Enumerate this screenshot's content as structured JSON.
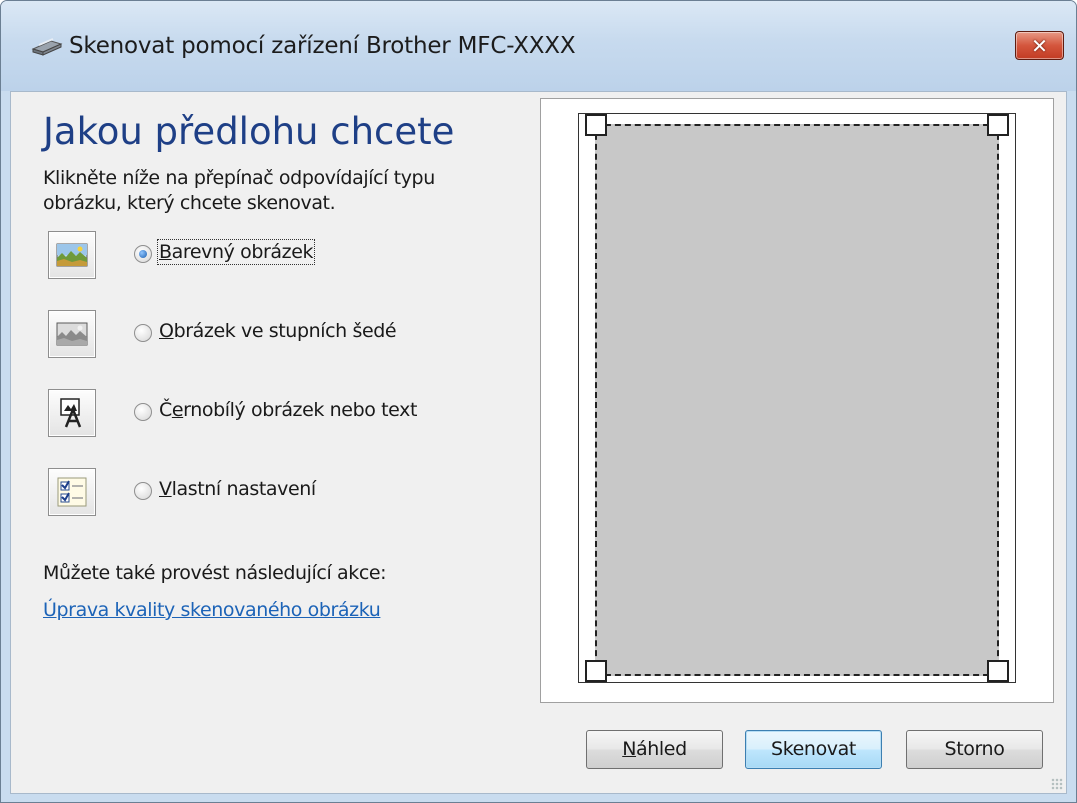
{
  "window": {
    "title": "Skenovat pomocí zařízení  Brother MFC-XXXX",
    "close_label": "✕"
  },
  "main": {
    "heading": "Jakou předlohu chcete",
    "instructions": "Klikněte níže na přepínač odpovídající typu obrázku, který chcete skenovat.",
    "options": [
      {
        "accel": "B",
        "rest": "arevný obrázek",
        "selected": true,
        "icon": "color-picture-icon"
      },
      {
        "accel": "O",
        "rest": "brázek ve stupních šedé",
        "selected": false,
        "icon": "grayscale-picture-icon"
      },
      {
        "pre": "Č",
        "accel": "e",
        "rest": "rnobílý obrázek nebo text",
        "selected": false,
        "icon": "black-white-text-icon"
      },
      {
        "accel": "V",
        "rest": "lastní nastavení",
        "selected": false,
        "icon": "custom-settings-icon"
      }
    ],
    "also_text": "Můžete také provést následující akce:",
    "link_text": "Úprava kvality skenovaného obrázku"
  },
  "buttons": {
    "preview_accel": "N",
    "preview_rest": "áhled",
    "scan_label": "Skenovat",
    "cancel_label": "Storno"
  },
  "colors": {
    "heading": "#1e3f86",
    "link": "#1c63b7",
    "close_button": "#c23b23"
  }
}
